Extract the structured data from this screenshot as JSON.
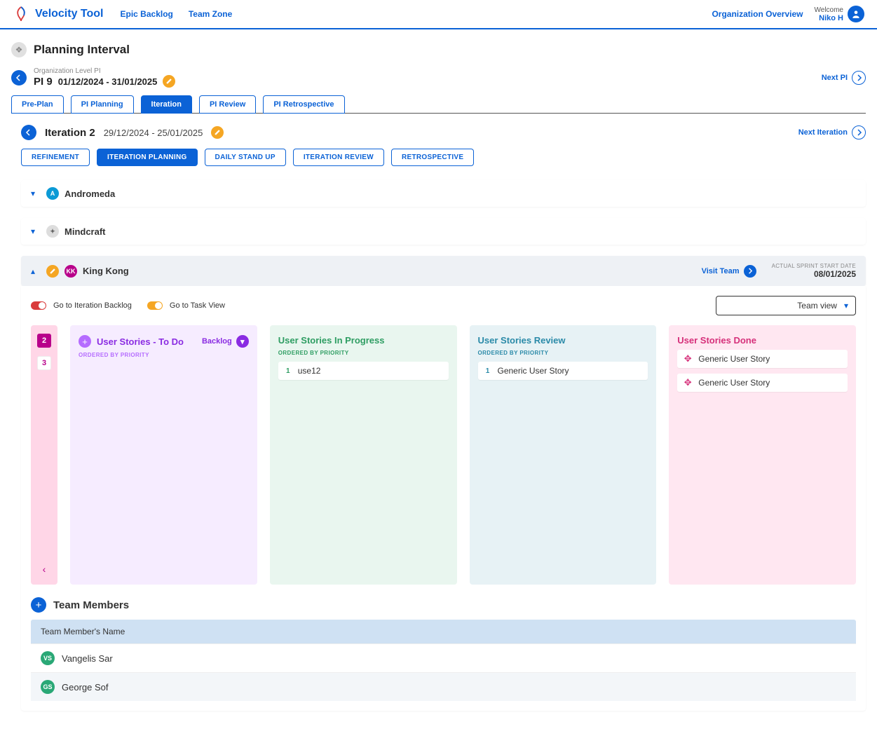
{
  "header": {
    "brand": "Velocity Tool",
    "nav": [
      "Epic Backlog",
      "Team Zone"
    ],
    "org_link": "Organization Overview",
    "welcome": "Welcome",
    "user": "Niko H"
  },
  "page_title": "Planning Interval",
  "pi": {
    "level_label": "Organization Level PI",
    "name": "PI 9",
    "dates": "01/12/2024 - 31/01/2025",
    "next": "Next PI"
  },
  "pi_tabs": [
    "Pre-Plan",
    "PI Planning",
    "Iteration",
    "PI Review",
    "PI Retrospective"
  ],
  "pi_tab_active": 2,
  "iteration": {
    "title": "Iteration 2",
    "dates": "29/12/2024 - 25/01/2025",
    "next": "Next Iteration"
  },
  "iter_pills": [
    "REFINEMENT",
    "ITERATION PLANNING",
    "DAILY STAND UP",
    "ITERATION REVIEW",
    "RETROSPECTIVE"
  ],
  "iter_pill_active": 1,
  "teams": [
    {
      "name": "Andromeda",
      "expanded": false,
      "avatar_bg": "#0b9ad6",
      "avatar_txt": "A"
    },
    {
      "name": "Mindcraft",
      "expanded": false,
      "avatar_bg": "#888",
      "avatar_txt": "✦"
    },
    {
      "name": "King Kong",
      "expanded": true,
      "avatar_bg": "#b8008a",
      "avatar_txt": "KK",
      "visit": "Visit Team",
      "sprint_label": "ACTUAL SPRINT START DATE",
      "sprint_date": "08/01/2025"
    }
  ],
  "toolbar": {
    "toggle1": "Go to Iteration Backlog",
    "toggle2": "Go to Task View",
    "view": "Team view"
  },
  "side_badges": [
    "2",
    "3"
  ],
  "columns": {
    "todo": {
      "title": "User Stories - To Do",
      "backlog": "Backlog",
      "order": "ORDERED BY PRIORITY"
    },
    "prog": {
      "title": "User Stories In Progress",
      "order": "ORDERED BY PRIORITY",
      "cards": [
        {
          "num": "1",
          "text": "use12"
        }
      ]
    },
    "rev": {
      "title": "User Stories Review",
      "order": "ORDERED BY PRIORITY",
      "cards": [
        {
          "num": "1",
          "text": "Generic User Story"
        }
      ]
    },
    "done": {
      "title": "User Stories Done",
      "cards": [
        {
          "text": "Generic User Story"
        },
        {
          "text": "Generic User Story"
        }
      ]
    }
  },
  "team_members": {
    "title": "Team Members",
    "col": "Team Member's Name",
    "rows": [
      {
        "initials": "VS",
        "name": "Vangelis Sar"
      },
      {
        "initials": "GS",
        "name": "George Sof"
      }
    ]
  }
}
